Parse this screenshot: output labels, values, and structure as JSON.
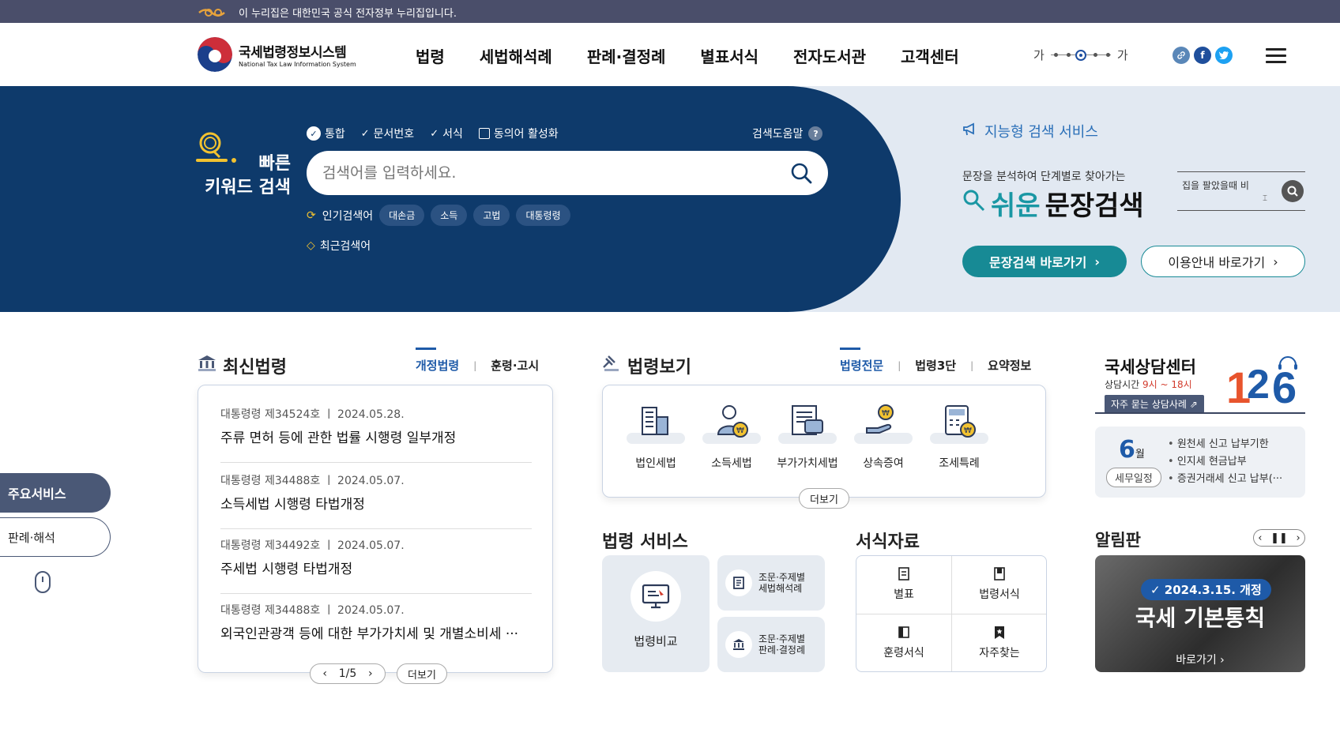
{
  "topbar": {
    "notice": "이 누리집은 대한민국 공식 전자정부 누리집입니다."
  },
  "logo": {
    "ko": "국세법령정보시스템",
    "en": "National Tax Law Information System"
  },
  "gnb": [
    "법령",
    "세법해석례",
    "판례·결정례",
    "별표서식",
    "전자도서관",
    "고객센터"
  ],
  "font_size": {
    "small": "가",
    "large": "가"
  },
  "sns": {
    "link": "link-icon",
    "facebook": "f",
    "twitter": "twitter-icon"
  },
  "quick_search": {
    "title_line1": "빠른",
    "title_line2": "키워드 검색",
    "options": [
      "통합",
      "문서번호",
      "서식",
      "동의어 활성화"
    ],
    "help": "검색도움말",
    "help_icon": "?",
    "placeholder": "검색어를 입력하세요.",
    "popular_label": "인기검색어",
    "popular_tags": [
      "대손금",
      "소득",
      "고법",
      "대통령령"
    ],
    "recent_label": "최근검색어"
  },
  "ai_search": {
    "title": "지능형 검색 서비스",
    "desc": "문장을 분석하여 단계별로 찾아가는",
    "big_easy": "쉬운",
    "big_doc": "문장검색",
    "sample_query": "집을 팔았을때 비",
    "btn_primary": "문장검색 바로가기",
    "btn_secondary": "이용안내 바로가기"
  },
  "side": {
    "main_services": "주요서비스",
    "cases": "판례·해석"
  },
  "latest_laws": {
    "title": "최신법령",
    "tabs": [
      "개정법령",
      "훈령·고시"
    ],
    "items": [
      {
        "meta": "대통령령 제34524호  ㅣ  2024.05.28.",
        "title": "주류 면허 등에 관한 법률 시행령 일부개정"
      },
      {
        "meta": "대통령령 제34488호  ㅣ  2024.05.07.",
        "title": "소득세법 시행령 타법개정"
      },
      {
        "meta": "대통령령 제34492호  ㅣ  2024.05.07.",
        "title": "주세법 시행령 타법개정"
      },
      {
        "meta": "대통령령 제34488호  ㅣ  2024.05.07.",
        "title": "외국인관광객 등에 대한 부가가치세 및 개별소비세 ···"
      }
    ],
    "pager": "1/5",
    "more": "더보기"
  },
  "law_view": {
    "title": "법령보기",
    "tabs": [
      "법령전문",
      "법령3단",
      "요약정보"
    ],
    "items": [
      "법인세법",
      "소득세법",
      "부가가치세법",
      "상속증여",
      "조세특례"
    ],
    "more": "더보기"
  },
  "law_service": {
    "title": "법령 서비스",
    "compare": "법령비교",
    "item1_line1": "조문·주제별",
    "item1_line2": "세법해석례",
    "item2_line1": "조문·주제별",
    "item2_line2": "판례·결정례"
  },
  "forms": {
    "title": "서식자료",
    "items": [
      "별표",
      "법령서식",
      "훈령서식",
      "자주찾는"
    ]
  },
  "consult": {
    "title": "국세상담센터",
    "hours_label": "상담시간",
    "hours": "9시 ~ 18시",
    "faq": "자주 묻는 상담사례",
    "number": "126",
    "month": "6",
    "month_unit": "월",
    "schedule_label": "세무일정",
    "schedule": [
      "원천세 신고 납부기한",
      "인지세 현금납부",
      "증권거래세 신고 납부(···"
    ]
  },
  "notice": {
    "title": "알림판",
    "badge": "2024.3.15. 개정",
    "headline": "국세 기본통칙",
    "go": "바로가기"
  },
  "colors": {
    "navy": "#0e3a6b",
    "teal": "#178a95",
    "blue": "#1e5aa8"
  }
}
